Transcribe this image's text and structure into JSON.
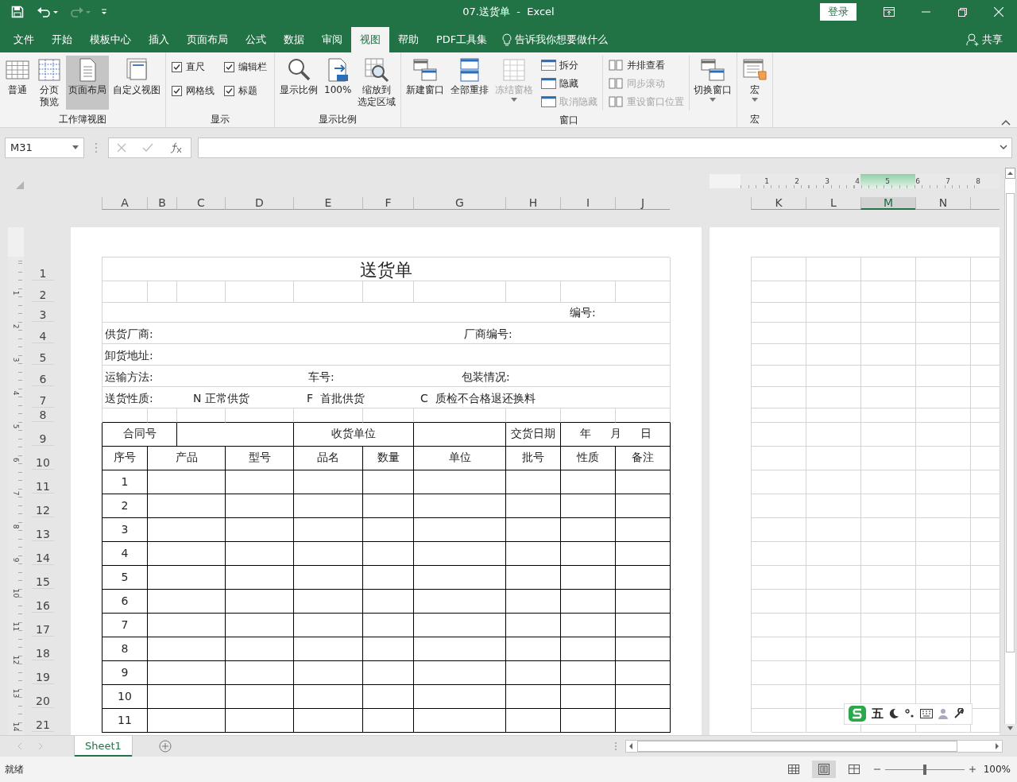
{
  "title_bar": {
    "title": "07.送货单  -  Excel",
    "login": "登录"
  },
  "menu_tabs": [
    {
      "label": "文件",
      "selected": false
    },
    {
      "label": "开始",
      "selected": false
    },
    {
      "label": "模板中心",
      "selected": false
    },
    {
      "label": "插入",
      "selected": false
    },
    {
      "label": "页面布局",
      "selected": false
    },
    {
      "label": "公式",
      "selected": false
    },
    {
      "label": "数据",
      "selected": false
    },
    {
      "label": "审阅",
      "selected": false
    },
    {
      "label": "视图",
      "selected": true
    },
    {
      "label": "帮助",
      "selected": false
    },
    {
      "label": "PDF工具集",
      "selected": false
    }
  ],
  "tell_me": "告诉我你想要做什么",
  "share": "共享",
  "ribbon": {
    "groups": [
      {
        "label": "工作簿视图",
        "items": [
          {
            "kind": "large",
            "label": "普通",
            "selected": false,
            "disabled": false,
            "dropdown": false
          },
          {
            "kind": "large",
            "label": [
              "分页",
              "预览"
            ],
            "selected": false,
            "disabled": false,
            "dropdown": false
          },
          {
            "kind": "large",
            "label": "页面布局",
            "selected": true,
            "disabled": false,
            "dropdown": false
          },
          {
            "kind": "large",
            "label": "自定义视图",
            "selected": false,
            "disabled": false,
            "dropdown": false
          }
        ]
      },
      {
        "label": "显示",
        "items": [
          {
            "kind": "stack",
            "items": [
              {
                "kind": "check",
                "label": "直尺",
                "checked": true
              },
              {
                "kind": "check",
                "label": "网格线",
                "checked": true
              }
            ]
          },
          {
            "kind": "stack",
            "items": [
              {
                "kind": "check",
                "label": "编辑栏",
                "checked": true
              },
              {
                "kind": "check",
                "label": "标题",
                "checked": true
              }
            ]
          }
        ]
      },
      {
        "label": "显示比例",
        "items": [
          {
            "kind": "large",
            "label": "显示比例",
            "disabled": false,
            "dropdown": false
          },
          {
            "kind": "large",
            "label": "100%",
            "disabled": false,
            "dropdown": false
          },
          {
            "kind": "large",
            "label": [
              "缩放到",
              "选定区域"
            ],
            "disabled": false,
            "dropdown": false
          }
        ]
      },
      {
        "label": "窗口",
        "items": [
          {
            "kind": "large",
            "label": "新建窗口",
            "disabled": false,
            "dropdown": false
          },
          {
            "kind": "large",
            "label": "全部重排",
            "disabled": false,
            "dropdown": false
          },
          {
            "kind": "large",
            "label": "冻结窗格",
            "disabled": true,
            "dropdown": true
          },
          {
            "kind": "stack",
            "items": [
              {
                "kind": "small",
                "label": "拆分",
                "disabled": false
              },
              {
                "kind": "small",
                "label": "隐藏",
                "disabled": false
              },
              {
                "kind": "small",
                "label": "取消隐藏",
                "disabled": true
              }
            ]
          },
          {
            "kind": "stack",
            "items": [
              {
                "kind": "small",
                "label": "并排查看",
                "disabled": false
              },
              {
                "kind": "small",
                "label": "同步滚动",
                "disabled": true
              },
              {
                "kind": "small",
                "label": "重设窗口位置",
                "disabled": true
              }
            ]
          },
          {
            "kind": "large",
            "label": "切换窗口",
            "disabled": false,
            "dropdown": true
          }
        ]
      },
      {
        "label": "宏",
        "items": [
          {
            "kind": "large",
            "label": "宏",
            "disabled": false,
            "dropdown": true
          }
        ]
      }
    ]
  },
  "formula_bar": {
    "name_box": "M31"
  },
  "sheet": {
    "left_columns": [
      {
        "label": "A",
        "selected": false
      },
      {
        "label": "B",
        "selected": false
      },
      {
        "label": "C",
        "selected": false
      },
      {
        "label": "D",
        "selected": false
      },
      {
        "label": "E",
        "selected": false
      },
      {
        "label": "F",
        "selected": false
      },
      {
        "label": "G",
        "selected": false
      },
      {
        "label": "H",
        "selected": false
      },
      {
        "label": "I",
        "selected": false
      },
      {
        "label": "J",
        "selected": false
      }
    ],
    "right_columns": [
      {
        "label": "K",
        "selected": false
      },
      {
        "label": "L",
        "selected": false
      },
      {
        "label": "M",
        "selected": true
      },
      {
        "label": "N",
        "selected": false
      }
    ],
    "row_headers": [
      "1",
      "2",
      "3",
      "4",
      "5",
      "6",
      "7",
      "8",
      "9",
      "10",
      "11",
      "12",
      "13",
      "14",
      "15",
      "16",
      "17",
      "18",
      "19",
      "20",
      "21"
    ],
    "horizontal_ruler": [
      "1",
      "2",
      "3",
      "4",
      "5",
      "6",
      "7",
      "8"
    ],
    "vertical_ruler": [
      "1",
      "2",
      "3",
      "4",
      "5",
      "6",
      "7",
      "8",
      "9",
      "10",
      "11",
      "12",
      "13",
      "14"
    ],
    "form": {
      "title": "送货单",
      "rows": [
        {
          "items": [
            "编号:"
          ]
        },
        {
          "items": [
            "供货厂商:",
            "厂商编号:"
          ]
        },
        {
          "items": [
            "卸货地址:"
          ]
        },
        {
          "items": [
            "运输方法:",
            "车号:",
            "包装情况:"
          ]
        },
        {
          "items": [
            "送货性质:",
            "N 正常供货",
            "F  首批供货",
            "C  质检不合格退还换料"
          ]
        }
      ]
    },
    "table": {
      "contract_label": "合同号",
      "receiver_label": "收货单位",
      "delivery_date_label": "交货日期",
      "date_parts": [
        "年",
        "月",
        "日"
      ],
      "columns": [
        "序号",
        "产品",
        "型号",
        "品名",
        "数量",
        "单位",
        "批号",
        "性质",
        "备注"
      ],
      "rows": [
        {
          "no": "1"
        },
        {
          "no": "2"
        },
        {
          "no": "3"
        },
        {
          "no": "4"
        },
        {
          "no": "5"
        },
        {
          "no": "6"
        },
        {
          "no": "7"
        },
        {
          "no": "8"
        },
        {
          "no": "9"
        },
        {
          "no": "10"
        },
        {
          "no": "11"
        }
      ]
    }
  },
  "ime_toolbar": {
    "mode": "五"
  },
  "sheet_tabs": [
    {
      "label": "Sheet1",
      "selected": true
    }
  ],
  "status_bar": {
    "status": "就绪",
    "views": [
      {
        "selected": false
      },
      {
        "selected": true
      },
      {
        "selected": false
      }
    ],
    "zoom": {
      "level": 0.5,
      "reading": "100%"
    }
  }
}
